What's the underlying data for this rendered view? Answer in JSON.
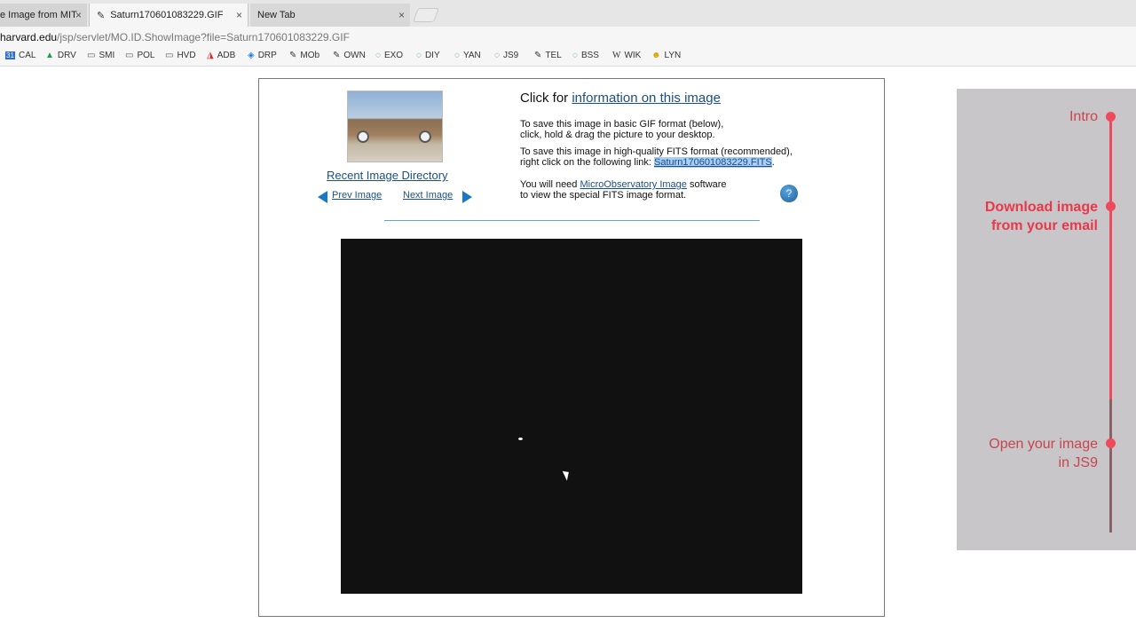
{
  "tabs": [
    {
      "label": "e Image from MIT",
      "active": false
    },
    {
      "label": "Saturn170601083229.GIF",
      "active": true
    },
    {
      "label": "New Tab",
      "active": false
    }
  ],
  "address": {
    "host": "harvard.edu",
    "path": "/jsp/servlet/MO.ID.ShowImage?file=Saturn170601083229.GIF"
  },
  "bookmarks": [
    {
      "label": "CAL",
      "icon": "calendar-icon"
    },
    {
      "label": "DRV",
      "icon": "drive-icon"
    },
    {
      "label": "SMI",
      "icon": "folder-icon"
    },
    {
      "label": "POL",
      "icon": "folder-icon"
    },
    {
      "label": "HVD",
      "icon": "folder-icon"
    },
    {
      "label": "ADB",
      "icon": "adobe-icon"
    },
    {
      "label": "DRP",
      "icon": "dropbox-icon"
    },
    {
      "label": "MOb",
      "icon": "telescope-icon"
    },
    {
      "label": "OWN",
      "icon": "telescope-icon"
    },
    {
      "label": "EXO",
      "icon": "saturn-icon"
    },
    {
      "label": "DIY",
      "icon": "saturn-icon"
    },
    {
      "label": "YAN",
      "icon": "saturn-icon"
    },
    {
      "label": "JS9",
      "icon": "saturn-icon"
    },
    {
      "label": "TEL",
      "icon": "telescope-icon"
    },
    {
      "label": "BSS",
      "icon": "saturn-icon"
    },
    {
      "label": "WIK",
      "icon": "wikipedia-icon"
    },
    {
      "label": "LYN",
      "icon": "smiley-icon"
    }
  ],
  "page": {
    "recent_directory": "Recent Image Directory",
    "prev_image": "Prev Image",
    "next_image": "Next Image",
    "click_for_prefix": "Click for ",
    "info_link": "information on this image",
    "gif_line1": "To save this image in basic GIF format (below),",
    "gif_line2": "click, hold & drag the picture to your desktop.",
    "fits_line1": "To save this image in high-quality FITS format (recommended),",
    "fits_line2_prefix": "right click on the following link: ",
    "fits_link": "Saturn170601083229.FITS",
    "fits_line2_suffix": ".",
    "software_prefix": "You will need ",
    "software_link": "MicroObservatory Image",
    "software_suffix": " software",
    "software_line2": "to view the special FITS image format.",
    "help_glyph": "?"
  },
  "steps": [
    {
      "label": "Intro",
      "active": false
    },
    {
      "label": "Download image from your email",
      "line1": "Download image",
      "line2": "from your email",
      "active": true
    },
    {
      "label": "Open your image in JS9",
      "line1": "Open your image",
      "line2": "in JS9",
      "active": false
    }
  ],
  "colors": {
    "accent": "#ee4a5b",
    "link": "#1a4f87",
    "panel": "#c8c6c8"
  }
}
